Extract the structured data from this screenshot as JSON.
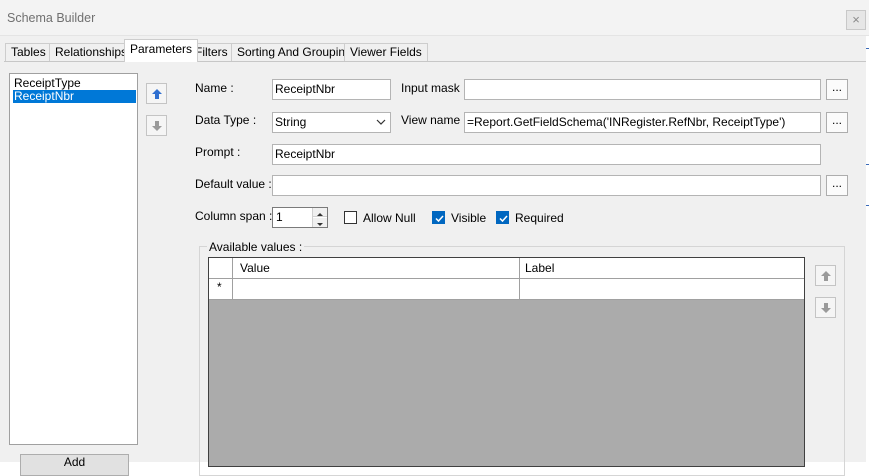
{
  "window": {
    "title": "Schema Builder",
    "close_glyph": "×"
  },
  "tabs": [
    {
      "label": "Tables"
    },
    {
      "label": "Relationships"
    },
    {
      "label": "Parameters",
      "active": true
    },
    {
      "label": "Filters"
    },
    {
      "label": "Sorting And Grouping"
    },
    {
      "label": "Viewer Fields"
    }
  ],
  "parameters": {
    "items": [
      {
        "label": "ReceiptType",
        "selected": false
      },
      {
        "label": "ReceiptNbr",
        "selected": true
      }
    ],
    "add_label": "Add"
  },
  "form": {
    "name_label": "Name :",
    "name_value": "ReceiptNbr",
    "input_mask_label": "Input mask :",
    "input_mask_value": "",
    "data_type_label": "Data Type :",
    "data_type_value": "String",
    "view_name_label": "View name :",
    "view_name_value": "=Report.GetFieldSchema('INRegister.RefNbr, ReceiptType')",
    "prompt_label": "Prompt :",
    "prompt_value": "ReceiptNbr",
    "default_value_label": "Default value :",
    "default_value_value": "",
    "column_span_label": "Column span :",
    "column_span_value": "1",
    "ellipsis_label": "...",
    "allow_null_label": "Allow Null",
    "allow_null_checked": false,
    "visible_label": "Visible",
    "visible_checked": true,
    "required_label": "Required",
    "required_checked": true
  },
  "available_values": {
    "title": "Available values :",
    "columns": [
      "Value",
      "Label"
    ],
    "new_row_marker": "*"
  },
  "icons": {
    "move_up": "arrow-up-icon",
    "move_down": "arrow-down-icon",
    "dropdown": "chevron-down-icon",
    "checkmark": "checkmark-icon"
  },
  "colors": {
    "selection": "#0078d7",
    "checkbox_checked": "#0067c0",
    "grid_background": "#ababab",
    "arrow_blue": "#2f6fd0"
  }
}
